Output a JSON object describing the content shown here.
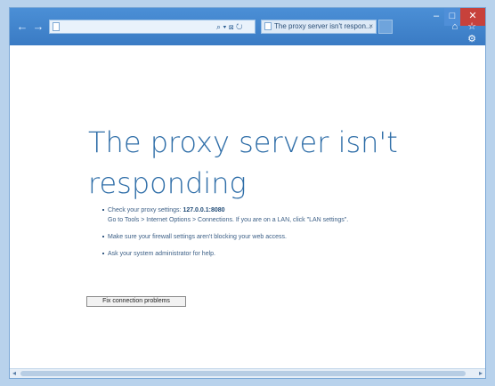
{
  "browser": {
    "tab_title": "The proxy server isn't respon...",
    "address_controls": "⌕ ▾ ⊠ ↻",
    "tab_close": "×",
    "window_controls": {
      "minimize": "–",
      "maximize": "□",
      "close": "✕"
    },
    "toolbar_icons": "⌂ ☆ ⚙",
    "nav": {
      "back": "←",
      "forward": "→"
    }
  },
  "error": {
    "title": "The proxy server isn't responding",
    "bullets": [
      {
        "line1_prefix": "Check your proxy settings: ",
        "line1_value": "127.0.0.1:8080",
        "line2": "Go to Tools > Internet Options > Connections. If you are on a LAN, click \"LAN settings\"."
      },
      {
        "text": "Make sure your firewall settings aren't blocking your web access."
      },
      {
        "text": "Ask your system administrator for help."
      }
    ],
    "fix_button": "Fix connection problems"
  },
  "scrollbar": {
    "left_arrow": "◂",
    "right_arrow": "▸"
  },
  "colors": {
    "titlebar": "#3a7bc4",
    "title_text": "#2f6ea8",
    "background": "#b8d2ec"
  }
}
